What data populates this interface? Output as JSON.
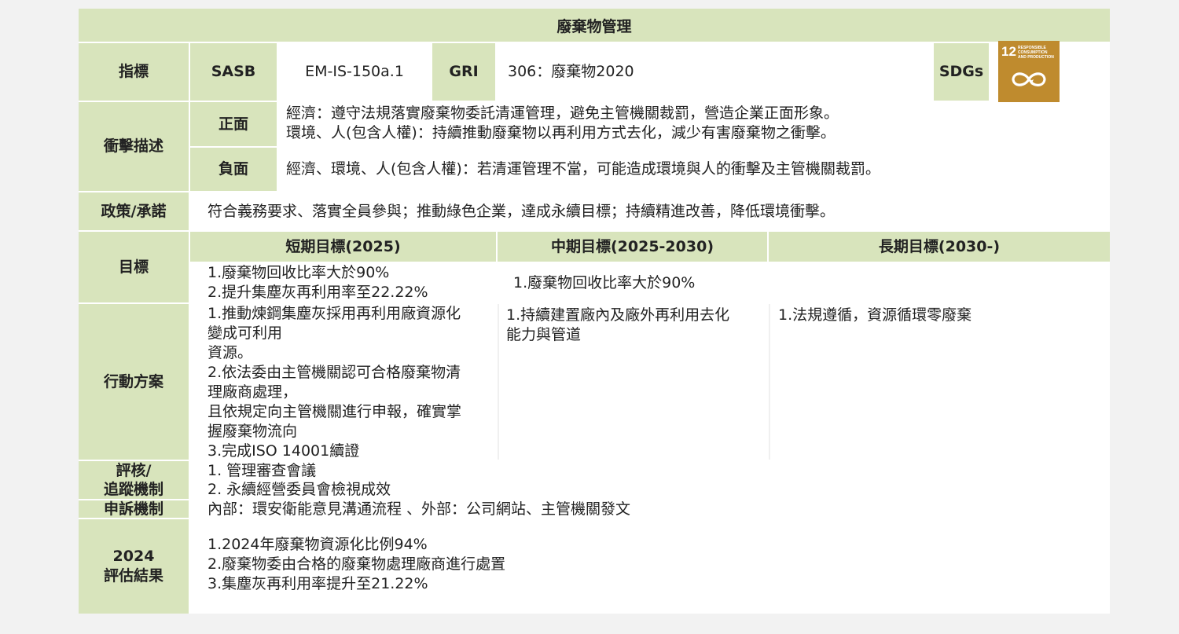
{
  "title": "廢棄物管理",
  "indicator": {
    "label": "指標",
    "sasb_label": "SASB",
    "sasb_value": "EM-IS-150a.1",
    "gri_label": "GRI",
    "gri_value": "306：廢棄物2020",
    "sdgs_label": "SDGs",
    "sdg_icon": {
      "number": "12",
      "text": [
        "RESPONSIBLE",
        "CONSUMPTION",
        "AND PRODUCTION"
      ],
      "icon": "infinity-loop-icon",
      "color": "#bf8b2e"
    }
  },
  "impact": {
    "label": "衝擊描述",
    "positive_label": "正面",
    "positive_lines": [
      "經濟：遵守法規落實廢棄物委託清運管理，避免主管機關裁罰，營造企業正面形象。",
      "環境、人(包含人權)：持續推動廢棄物以再利用方式去化，減少有害廢棄物之衝擊。"
    ],
    "negative_label": "負面",
    "negative_text": "經濟、環境、人(包含人權)：若清運管理不當，可能造成環境與人的衝擊及主管機關裁罰。"
  },
  "policy": {
    "label": "政策/承諾",
    "text": "符合義務要求、落實全員參與；推動綠色企業，達成永續目標；持續精進改善，降低環境衝擊。"
  },
  "goals": {
    "label": "目標",
    "short_label": "短期目標(2025)",
    "mid_label": "中期目標(2025-2030)",
    "long_label": "長期目標(2030-)",
    "short_lines": [
      "1.廢棄物回收比率大於90%",
      "2.提升集塵灰再利用率至22.22%"
    ],
    "mid_long_text": "1.廢棄物回收比率大於90%"
  },
  "actions": {
    "label": "行動方案",
    "short_lines": [
      "1.推動煉鋼集塵灰採用再利用廠資源化",
      "變成可利用",
      "資源。",
      "2.依法委由主管機關認可合格廢棄物清",
      "理廠商處理，",
      "且依規定向主管機關進行申報，確實掌",
      "握廢棄物流向",
      "3.完成ISO 14001續證"
    ],
    "mid_lines": [
      "1.持續建置廠內及廠外再利用去化",
      "能力與管道"
    ],
    "long_text": "1.法規遵循，資源循環零廢棄"
  },
  "tracking": {
    "label_lines": [
      "評核/",
      "追蹤機制"
    ],
    "lines": [
      "1. 管理審查會議",
      "2. 永續經營委員會檢視成效"
    ]
  },
  "grievance": {
    "label": "申訴機制",
    "text": "內部：環安衛能意見溝通流程 、外部：公司網站、主管機關發文"
  },
  "results": {
    "label_lines": [
      "2024",
      "評估結果"
    ],
    "lines": [
      "1.2024年廢棄物資源化比例94%",
      "2.廢棄物委由合格的廢棄物處理廠商進行處置",
      "3.集塵灰再利用率提升至21.22%"
    ]
  },
  "colors": {
    "header_green": "#d8e4bc",
    "page_bg": "#f2f2f2",
    "sdg_gold": "#bf8b2e"
  }
}
